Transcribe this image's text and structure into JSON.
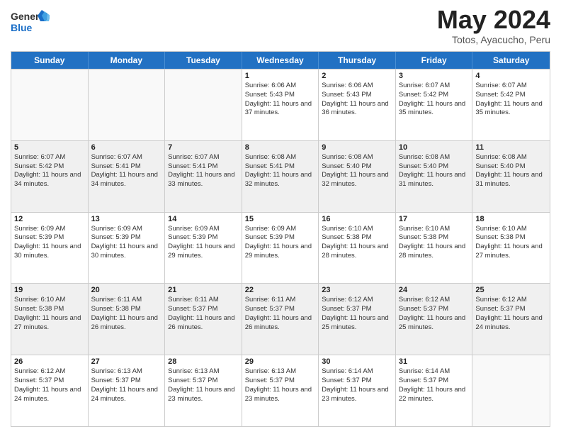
{
  "logo": {
    "text_general": "General",
    "text_blue": "Blue"
  },
  "title": "May 2024",
  "subtitle": "Totos, Ayacucho, Peru",
  "header_days": [
    "Sunday",
    "Monday",
    "Tuesday",
    "Wednesday",
    "Thursday",
    "Friday",
    "Saturday"
  ],
  "weeks": [
    [
      {
        "day": "",
        "info": ""
      },
      {
        "day": "",
        "info": ""
      },
      {
        "day": "",
        "info": ""
      },
      {
        "day": "1",
        "sr": "6:06 AM",
        "ss": "5:43 PM",
        "dl": "11 hours and 37 minutes."
      },
      {
        "day": "2",
        "sr": "6:06 AM",
        "ss": "5:43 PM",
        "dl": "11 hours and 36 minutes."
      },
      {
        "day": "3",
        "sr": "6:07 AM",
        "ss": "5:42 PM",
        "dl": "11 hours and 35 minutes."
      },
      {
        "day": "4",
        "sr": "6:07 AM",
        "ss": "5:42 PM",
        "dl": "11 hours and 35 minutes."
      }
    ],
    [
      {
        "day": "5",
        "sr": "6:07 AM",
        "ss": "5:42 PM",
        "dl": "11 hours and 34 minutes."
      },
      {
        "day": "6",
        "sr": "6:07 AM",
        "ss": "5:41 PM",
        "dl": "11 hours and 34 minutes."
      },
      {
        "day": "7",
        "sr": "6:07 AM",
        "ss": "5:41 PM",
        "dl": "11 hours and 33 minutes."
      },
      {
        "day": "8",
        "sr": "6:08 AM",
        "ss": "5:41 PM",
        "dl": "11 hours and 32 minutes."
      },
      {
        "day": "9",
        "sr": "6:08 AM",
        "ss": "5:40 PM",
        "dl": "11 hours and 32 minutes."
      },
      {
        "day": "10",
        "sr": "6:08 AM",
        "ss": "5:40 PM",
        "dl": "11 hours and 31 minutes."
      },
      {
        "day": "11",
        "sr": "6:08 AM",
        "ss": "5:40 PM",
        "dl": "11 hours and 31 minutes."
      }
    ],
    [
      {
        "day": "12",
        "sr": "6:09 AM",
        "ss": "5:39 PM",
        "dl": "11 hours and 30 minutes."
      },
      {
        "day": "13",
        "sr": "6:09 AM",
        "ss": "5:39 PM",
        "dl": "11 hours and 30 minutes."
      },
      {
        "day": "14",
        "sr": "6:09 AM",
        "ss": "5:39 PM",
        "dl": "11 hours and 29 minutes."
      },
      {
        "day": "15",
        "sr": "6:09 AM",
        "ss": "5:39 PM",
        "dl": "11 hours and 29 minutes."
      },
      {
        "day": "16",
        "sr": "6:10 AM",
        "ss": "5:38 PM",
        "dl": "11 hours and 28 minutes."
      },
      {
        "day": "17",
        "sr": "6:10 AM",
        "ss": "5:38 PM",
        "dl": "11 hours and 28 minutes."
      },
      {
        "day": "18",
        "sr": "6:10 AM",
        "ss": "5:38 PM",
        "dl": "11 hours and 27 minutes."
      }
    ],
    [
      {
        "day": "19",
        "sr": "6:10 AM",
        "ss": "5:38 PM",
        "dl": "11 hours and 27 minutes."
      },
      {
        "day": "20",
        "sr": "6:11 AM",
        "ss": "5:38 PM",
        "dl": "11 hours and 26 minutes."
      },
      {
        "day": "21",
        "sr": "6:11 AM",
        "ss": "5:37 PM",
        "dl": "11 hours and 26 minutes."
      },
      {
        "day": "22",
        "sr": "6:11 AM",
        "ss": "5:37 PM",
        "dl": "11 hours and 26 minutes."
      },
      {
        "day": "23",
        "sr": "6:12 AM",
        "ss": "5:37 PM",
        "dl": "11 hours and 25 minutes."
      },
      {
        "day": "24",
        "sr": "6:12 AM",
        "ss": "5:37 PM",
        "dl": "11 hours and 25 minutes."
      },
      {
        "day": "25",
        "sr": "6:12 AM",
        "ss": "5:37 PM",
        "dl": "11 hours and 24 minutes."
      }
    ],
    [
      {
        "day": "26",
        "sr": "6:12 AM",
        "ss": "5:37 PM",
        "dl": "11 hours and 24 minutes."
      },
      {
        "day": "27",
        "sr": "6:13 AM",
        "ss": "5:37 PM",
        "dl": "11 hours and 24 minutes."
      },
      {
        "day": "28",
        "sr": "6:13 AM",
        "ss": "5:37 PM",
        "dl": "11 hours and 23 minutes."
      },
      {
        "day": "29",
        "sr": "6:13 AM",
        "ss": "5:37 PM",
        "dl": "11 hours and 23 minutes."
      },
      {
        "day": "30",
        "sr": "6:14 AM",
        "ss": "5:37 PM",
        "dl": "11 hours and 23 minutes."
      },
      {
        "day": "31",
        "sr": "6:14 AM",
        "ss": "5:37 PM",
        "dl": "11 hours and 22 minutes."
      },
      {
        "day": "",
        "info": ""
      }
    ]
  ]
}
